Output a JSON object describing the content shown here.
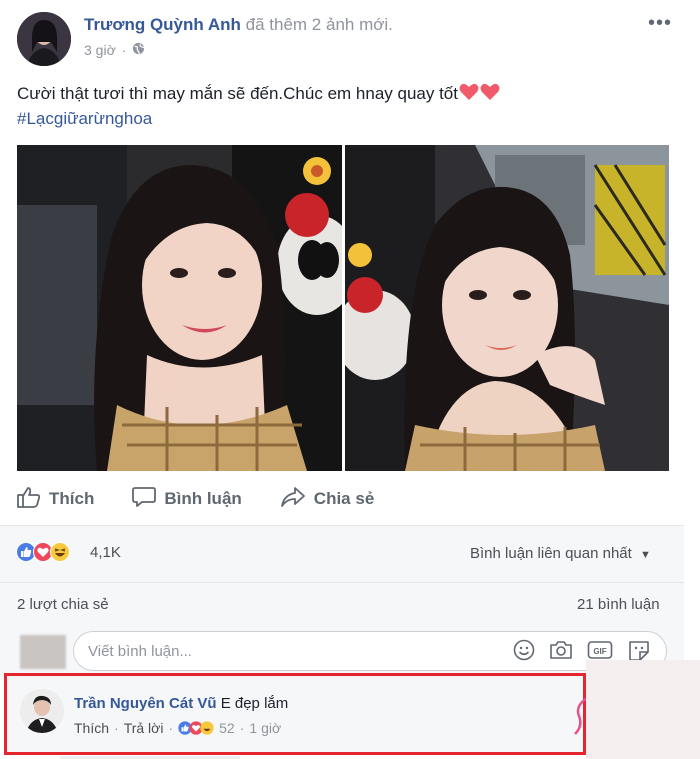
{
  "post": {
    "author": "Trương Quỳnh Anh",
    "action_text": "đã thêm 2 ảnh mới.",
    "time": "3 giờ",
    "privacy_icon": "globe-icon",
    "caption": "Cười thật tươi thì may mắn sẽ đến.Chúc em hnay quay tốt",
    "hashtag": "#Lạcgiữarừnghoa"
  },
  "actions": {
    "like": "Thích",
    "comment": "Bình luận",
    "share": "Chia sẻ"
  },
  "reactions": {
    "icons": [
      "like-reaction-icon",
      "love-reaction-icon",
      "haha-reaction-icon"
    ],
    "count": "4,1K",
    "sort_label": "Bình luận liên quan nhất"
  },
  "stats": {
    "shares": "2 lượt chia sẻ",
    "comments": "21 bình luận"
  },
  "comment_box": {
    "placeholder": "Viết bình luận..."
  },
  "top_comment": {
    "author": "Trần Nguyên Cát Vũ",
    "text": "E đẹp lắm",
    "like": "Thích",
    "reply": "Trả lời",
    "reaction_count": "52",
    "time": "1 giờ"
  },
  "colors": {
    "link_blue": "#365899",
    "highlight_red": "#e5262e",
    "heart_red": "#f05a6a"
  }
}
